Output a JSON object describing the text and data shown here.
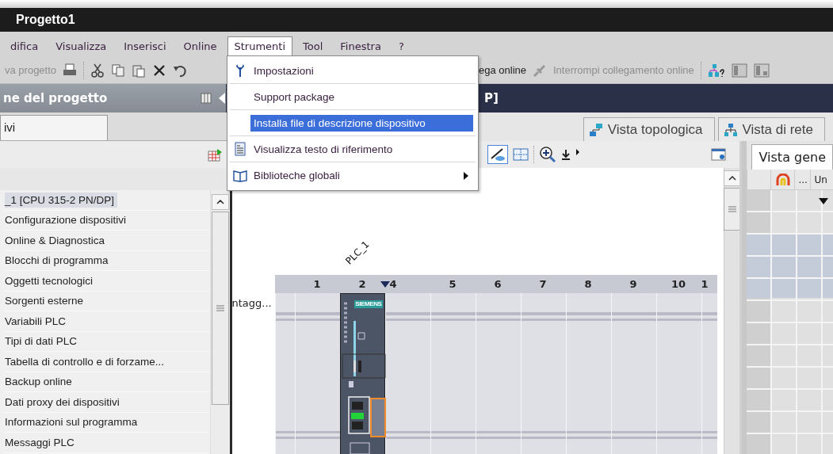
{
  "window": {
    "title": "Progetto1"
  },
  "menu_bar": [
    {
      "label": "difica",
      "selected": false
    },
    {
      "label": "Visualizza",
      "selected": false
    },
    {
      "label": "Inserisci",
      "selected": false
    },
    {
      "label": "Online",
      "selected": false
    },
    {
      "label": "Strumenti",
      "selected": true
    },
    {
      "label": "Tool",
      "selected": false
    },
    {
      "label": "Finestra",
      "selected": false
    },
    {
      "label": "?",
      "selected": false
    }
  ],
  "toolbar": {
    "save": {
      "label": "va progetto",
      "disabled": true
    },
    "go_online": {
      "label": "ega online",
      "disabled": false
    },
    "go_offline": {
      "label": "Interrompi collegamento online",
      "disabled": true
    }
  },
  "project_panel": {
    "title": "ne del progetto",
    "tab": "ivi",
    "tree": [
      {
        "label": "_1 [CPU 315-2 PN/DP]",
        "selected": true
      },
      {
        "label": "Configurazione dispositivi",
        "selected": false
      },
      {
        "label": "Online & Diagnostica",
        "selected": false
      },
      {
        "label": "Blocchi di programma",
        "selected": false
      },
      {
        "label": "Oggetti tecnologici",
        "selected": false
      },
      {
        "label": "Sorgenti esterne",
        "selected": false
      },
      {
        "label": "Variabili PLC",
        "selected": false
      },
      {
        "label": "Tipi di dati PLC",
        "selected": false
      },
      {
        "label": "Tabella di controllo e di forzame...",
        "selected": false
      },
      {
        "label": "Backup online",
        "selected": false
      },
      {
        "label": "Dati proxy dei dispositivi",
        "selected": false
      },
      {
        "label": "Informazioni sul programma",
        "selected": false
      },
      {
        "label": "Messaggi PLC",
        "selected": false
      }
    ]
  },
  "editor": {
    "title": "P]",
    "view_tabs": [
      {
        "label": "Vista topologica",
        "kind": "topology",
        "selected": false
      },
      {
        "label": "Vista di rete",
        "kind": "network",
        "selected": false
      }
    ],
    "rack": {
      "row_label": "ntagg...",
      "device_label": "PLC_1",
      "module_brand": "SIEMENS",
      "slots": [
        {
          "label": "1",
          "occupied": false,
          "insert_marker": false
        },
        {
          "label": "2",
          "occupied": true,
          "insert_marker": false
        },
        {
          "label": "4",
          "occupied": false,
          "insert_marker": true
        },
        {
          "label": "5",
          "occupied": false,
          "insert_marker": false
        },
        {
          "label": "6",
          "occupied": false,
          "insert_marker": false
        },
        {
          "label": "7",
          "occupied": false,
          "insert_marker": false
        },
        {
          "label": "8",
          "occupied": false,
          "insert_marker": false
        },
        {
          "label": "9",
          "occupied": false,
          "insert_marker": false
        },
        {
          "label": "10",
          "occupied": false,
          "insert_marker": false
        },
        {
          "label": "1",
          "occupied": false,
          "insert_marker": false
        }
      ]
    }
  },
  "overview_panel": {
    "tab": "Vista gene",
    "columns": [
      "...",
      "Un"
    ]
  },
  "tools_menu": [
    {
      "label": "Impostazioni",
      "kind": "settings",
      "selected": false,
      "submenu": false
    },
    {
      "label": "Support package",
      "kind": "plain",
      "selected": false,
      "submenu": false
    },
    {
      "label": "Installa file di descrizione dispositivo",
      "kind": "plain",
      "selected": true,
      "submenu": false
    },
    {
      "label": "Visualizza testo di riferimento",
      "kind": "reference",
      "selected": false,
      "submenu": false
    },
    {
      "label": "Biblioteche globali",
      "kind": "library",
      "selected": false,
      "submenu": true
    }
  ]
}
